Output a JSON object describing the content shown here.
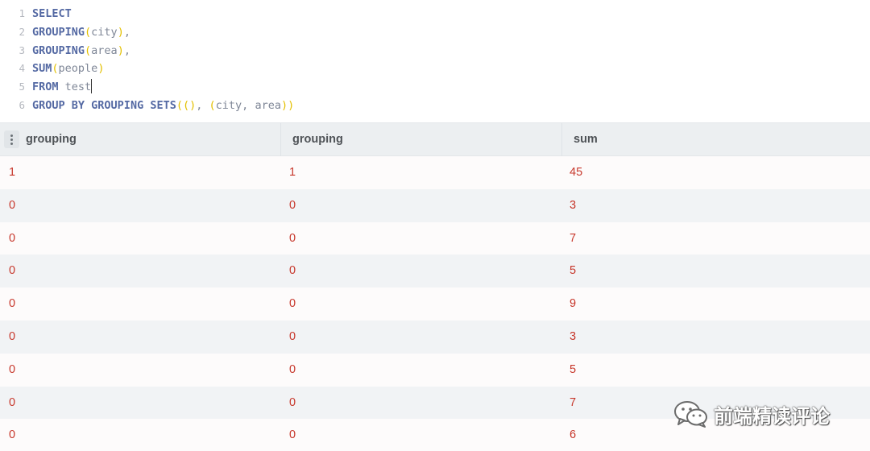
{
  "editor": {
    "lines": [
      {
        "num": "1",
        "tokens": [
          {
            "t": "SELECT",
            "c": "kw"
          }
        ]
      },
      {
        "num": "2",
        "tokens": [
          {
            "t": "GROUPING",
            "c": "kw"
          },
          {
            "t": "(",
            "c": "br"
          },
          {
            "t": "city",
            "c": "id"
          },
          {
            "t": ")",
            "c": "br"
          },
          {
            "t": ",",
            "c": "pn"
          }
        ]
      },
      {
        "num": "3",
        "tokens": [
          {
            "t": "GROUPING",
            "c": "kw"
          },
          {
            "t": "(",
            "c": "br"
          },
          {
            "t": "area",
            "c": "id"
          },
          {
            "t": ")",
            "c": "br"
          },
          {
            "t": ",",
            "c": "pn"
          }
        ]
      },
      {
        "num": "4",
        "tokens": [
          {
            "t": "SUM",
            "c": "kw"
          },
          {
            "t": "(",
            "c": "br"
          },
          {
            "t": "people",
            "c": "id"
          },
          {
            "t": ")",
            "c": "br"
          }
        ]
      },
      {
        "num": "5",
        "tokens": [
          {
            "t": "FROM",
            "c": "kw"
          },
          {
            "t": " ",
            "c": "pn"
          },
          {
            "t": "test",
            "c": "id"
          }
        ],
        "cursor": true
      },
      {
        "num": "6",
        "tokens": [
          {
            "t": "GROUP BY",
            "c": "kw"
          },
          {
            "t": " ",
            "c": "pn"
          },
          {
            "t": "GROUPING SETS",
            "c": "kw"
          },
          {
            "t": "((",
            "c": "br"
          },
          {
            "t": ")",
            "c": "br"
          },
          {
            "t": ", ",
            "c": "pn"
          },
          {
            "t": "(",
            "c": "br"
          },
          {
            "t": "city",
            "c": "id"
          },
          {
            "t": ", ",
            "c": "pn"
          },
          {
            "t": "area",
            "c": "id"
          },
          {
            "t": "))",
            "c": "br"
          }
        ]
      }
    ]
  },
  "results": {
    "columns": [
      "grouping",
      "grouping",
      "sum"
    ],
    "rows": [
      [
        "1",
        "1",
        "45"
      ],
      [
        "0",
        "0",
        "3"
      ],
      [
        "0",
        "0",
        "7"
      ],
      [
        "0",
        "0",
        "5"
      ],
      [
        "0",
        "0",
        "9"
      ],
      [
        "0",
        "0",
        "3"
      ],
      [
        "0",
        "0",
        "5"
      ],
      [
        "0",
        "0",
        "7"
      ],
      [
        "0",
        "0",
        "6"
      ]
    ]
  },
  "watermark": {
    "text": "前端精读评论",
    "icon": "wechat-icon"
  },
  "colors": {
    "keyword": "#5469a3",
    "bracket": "#e3c000",
    "identifier": "#7f8797",
    "cell_value": "#c7372b",
    "header_bg": "#eceff1",
    "row_alt_bg": "#f1f3f5"
  }
}
